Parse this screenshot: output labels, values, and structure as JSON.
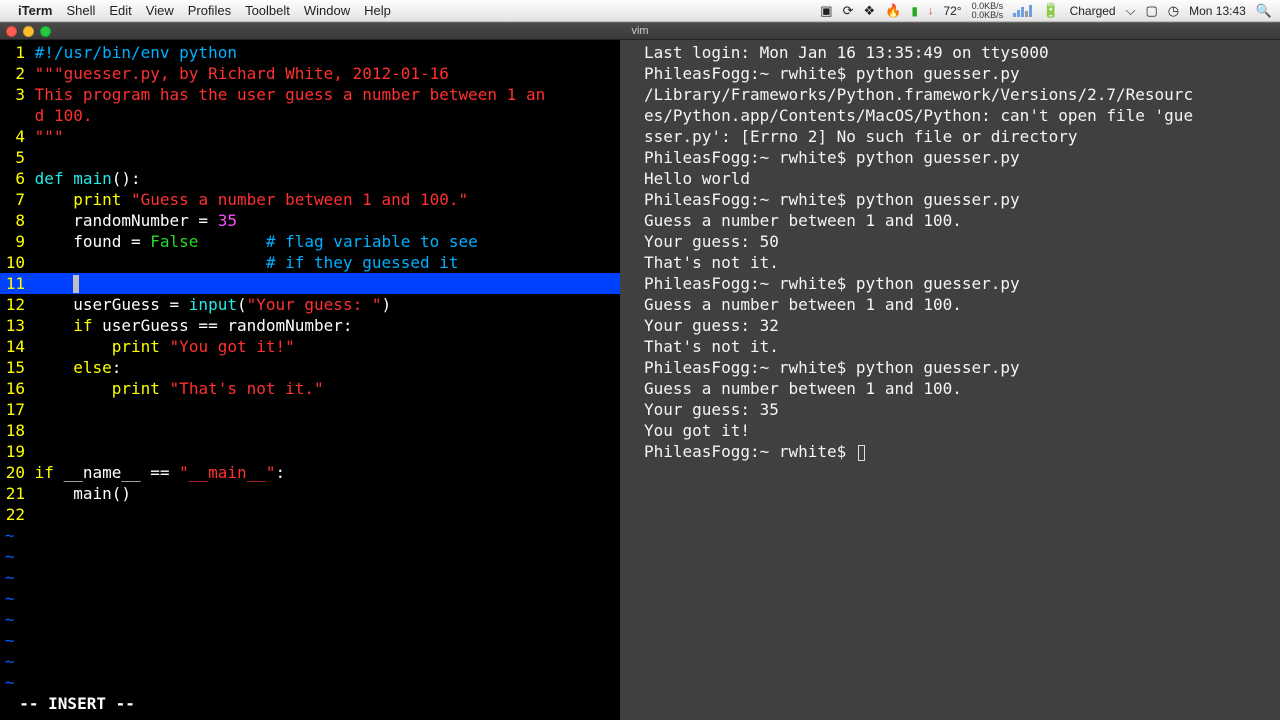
{
  "menubar": {
    "app": "iTerm",
    "items": [
      "Shell",
      "Edit",
      "View",
      "Profiles",
      "Toolbelt",
      "Window",
      "Help"
    ],
    "temp": "72°",
    "net_up": "0.0KB/s",
    "net_dn": "0.0KB/s",
    "battery": "Charged",
    "clock": "Mon 13:43"
  },
  "window": {
    "title": "vim"
  },
  "vim": {
    "lines": [
      {
        "n": "1",
        "seg": [
          {
            "c": "c-cmt",
            "t": "#!/usr/bin/env python"
          }
        ]
      },
      {
        "n": "2",
        "seg": [
          {
            "c": "c-red",
            "t": "\"\"\"guesser.py, by Richard White, 2012-01-16"
          }
        ]
      },
      {
        "n": "3",
        "seg": [
          {
            "c": "c-red",
            "t": "This program has the user guess a number between 1 an"
          }
        ]
      },
      {
        "n": "",
        "seg": [
          {
            "c": "c-red",
            "t": "d 100."
          }
        ],
        "cont": true
      },
      {
        "n": "4",
        "seg": [
          {
            "c": "c-red",
            "t": "\"\"\""
          }
        ]
      },
      {
        "n": "5",
        "seg": []
      },
      {
        "n": "6",
        "seg": [
          {
            "c": "c-cyan",
            "t": "def"
          },
          {
            "c": "c-wht",
            "t": " "
          },
          {
            "c": "c-cyan",
            "t": "main"
          },
          {
            "c": "c-wht",
            "t": "():"
          }
        ]
      },
      {
        "n": "7",
        "seg": [
          {
            "c": "c-wht",
            "t": "    "
          },
          {
            "c": "c-yel",
            "t": "print"
          },
          {
            "c": "c-wht",
            "t": " "
          },
          {
            "c": "c-red",
            "t": "\"Guess a number between 1 and 100.\""
          }
        ]
      },
      {
        "n": "8",
        "seg": [
          {
            "c": "c-wht",
            "t": "    randomNumber = "
          },
          {
            "c": "c-mag",
            "t": "35"
          }
        ]
      },
      {
        "n": "9",
        "seg": [
          {
            "c": "c-wht",
            "t": "    found = "
          },
          {
            "c": "c-grn",
            "t": "False"
          },
          {
            "c": "c-wht",
            "t": "       "
          },
          {
            "c": "c-cmt",
            "t": "# flag variable to see"
          }
        ]
      },
      {
        "n": "10",
        "seg": [
          {
            "c": "c-wht",
            "t": "                        "
          },
          {
            "c": "c-cmt",
            "t": "# if they guessed it"
          }
        ]
      },
      {
        "n": "11",
        "sel": true,
        "seg": [
          {
            "c": "c-wht",
            "t": "    "
          }
        ],
        "cursor": true
      },
      {
        "n": "12",
        "seg": [
          {
            "c": "c-wht",
            "t": "    userGuess = "
          },
          {
            "c": "c-cyan",
            "t": "input"
          },
          {
            "c": "c-wht",
            "t": "("
          },
          {
            "c": "c-red",
            "t": "\"Your guess: \""
          },
          {
            "c": "c-wht",
            "t": ")"
          }
        ]
      },
      {
        "n": "13",
        "seg": [
          {
            "c": "c-wht",
            "t": "    "
          },
          {
            "c": "c-yel",
            "t": "if"
          },
          {
            "c": "c-wht",
            "t": " userGuess == randomNumber:"
          }
        ]
      },
      {
        "n": "14",
        "seg": [
          {
            "c": "c-wht",
            "t": "        "
          },
          {
            "c": "c-yel",
            "t": "print"
          },
          {
            "c": "c-wht",
            "t": " "
          },
          {
            "c": "c-red",
            "t": "\"You got it!\""
          }
        ]
      },
      {
        "n": "15",
        "seg": [
          {
            "c": "c-wht",
            "t": "    "
          },
          {
            "c": "c-yel",
            "t": "else"
          },
          {
            "c": "c-wht",
            "t": ":"
          }
        ]
      },
      {
        "n": "16",
        "seg": [
          {
            "c": "c-wht",
            "t": "        "
          },
          {
            "c": "c-yel",
            "t": "print"
          },
          {
            "c": "c-wht",
            "t": " "
          },
          {
            "c": "c-red",
            "t": "\"That's not it.\""
          }
        ]
      },
      {
        "n": "17",
        "seg": []
      },
      {
        "n": "18",
        "seg": []
      },
      {
        "n": "19",
        "seg": []
      },
      {
        "n": "20",
        "seg": [
          {
            "c": "c-yel",
            "t": "if"
          },
          {
            "c": "c-wht",
            "t": " __name__ == "
          },
          {
            "c": "c-red",
            "t": "\"__main__\""
          },
          {
            "c": "c-wht",
            "t": ":"
          }
        ]
      },
      {
        "n": "21",
        "seg": [
          {
            "c": "c-wht",
            "t": "    main()"
          }
        ]
      },
      {
        "n": "22",
        "seg": []
      }
    ],
    "tilde_rows": 8,
    "status": "-- INSERT --"
  },
  "shell": {
    "lines": [
      "Last login: Mon Jan 16 13:35:49 on ttys000",
      "PhileasFogg:~ rwhite$ python guesser.py",
      "/Library/Frameworks/Python.framework/Versions/2.7/Resourc",
      "es/Python.app/Contents/MacOS/Python: can't open file 'gue",
      "sser.py': [Errno 2] No such file or directory",
      "PhileasFogg:~ rwhite$ python guesser.py",
      "Hello world",
      "PhileasFogg:~ rwhite$ python guesser.py",
      "Guess a number between 1 and 100.",
      "Your guess: 50",
      "That's not it.",
      "PhileasFogg:~ rwhite$ python guesser.py",
      "Guess a number between 1 and 100.",
      "Your guess: 32",
      "That's not it.",
      "PhileasFogg:~ rwhite$ python guesser.py",
      "Guess a number between 1 and 100.",
      "Your guess: 35",
      "You got it!",
      "PhileasFogg:~ rwhite$ "
    ]
  }
}
